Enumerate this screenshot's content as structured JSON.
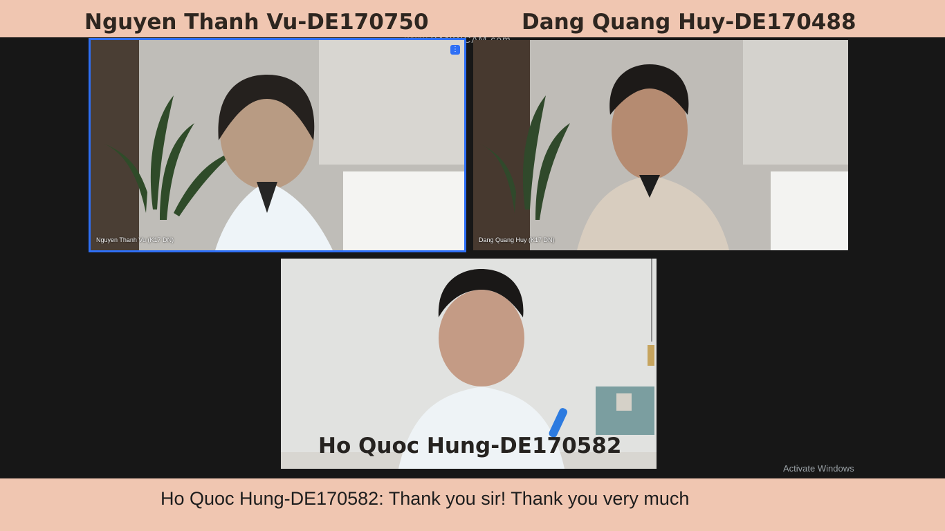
{
  "banner": {
    "left_name": "Nguyen Thanh Vu-DE170750",
    "right_name": "Dang Quang Huy-DE170488"
  },
  "watermark": "www.BANDICAM.com",
  "tiles": [
    {
      "caption": "Nguyen Thanh Vu (K17 DN)",
      "active": true,
      "speaking_icon": "speaking-indicator-icon"
    },
    {
      "caption": "Dang Quang Huy (K17 DN)",
      "active": false
    },
    {
      "caption": "",
      "overlay_name": "Ho Quoc Hung-DE170582",
      "active": false
    }
  ],
  "system_notice": "Activate Windows",
  "subtitle": "Ho Quoc Hung-DE170582: Thank you sir! Thank you very much",
  "colors": {
    "banner": "#f0c6b1",
    "stage": "#171717",
    "active_speaker_border": "#2e6ff5"
  }
}
